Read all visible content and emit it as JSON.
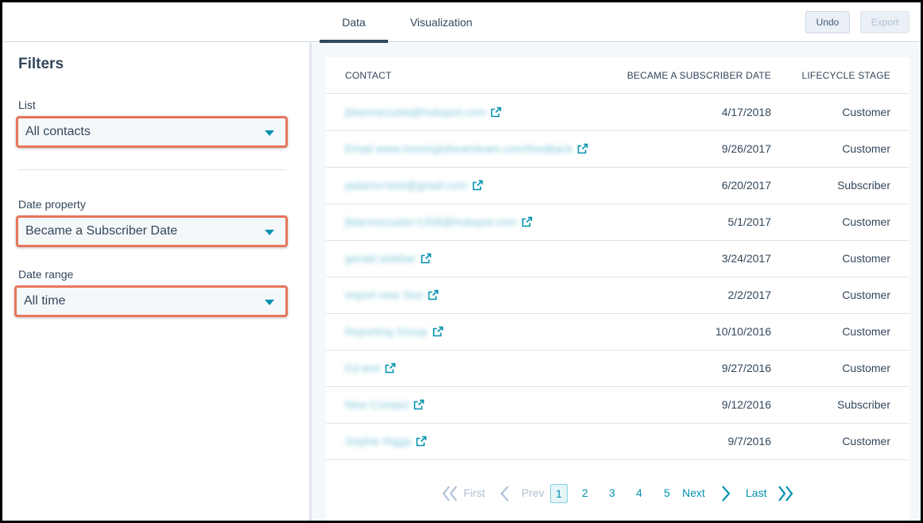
{
  "tabs": [
    {
      "label": "Data",
      "active": true
    },
    {
      "label": "Visualization",
      "active": false
    }
  ],
  "toolbar": {
    "undo_label": "Undo",
    "export_label": "Export"
  },
  "filters": {
    "title": "Filters",
    "list_label": "List",
    "list_value": "All contacts",
    "date_property_label": "Date property",
    "date_property_value": "Became a Subscriber Date",
    "date_range_label": "Date range",
    "date_range_value": "All time"
  },
  "table": {
    "columns": [
      "CONTACT",
      "BECAME A SUBSCRIBER DATE",
      "LIFECYCLE STAGE"
    ],
    "rows": [
      {
        "contact": "jblanmezuela@hubspot.com",
        "date": "4/17/2018",
        "stage": "Customer"
      },
      {
        "contact": "Email www.movingtobeamteam.com/feedback",
        "date": "9/26/2017",
        "stage": "Customer"
      },
      {
        "contact": "jadams+test@gmail.com",
        "date": "6/20/2017",
        "stage": "Subscriber"
      },
      {
        "contact": "jblanmezuela+1208@hubspot.com",
        "date": "5/1/2017",
        "stage": "Customer"
      },
      {
        "contact": "gerald sidebar",
        "date": "3/24/2017",
        "stage": "Customer"
      },
      {
        "contact": "import new Test",
        "date": "2/2/2017",
        "stage": "Customer"
      },
      {
        "contact": "Reporting Group",
        "date": "10/10/2016",
        "stage": "Customer"
      },
      {
        "contact": "Ed test",
        "date": "9/27/2016",
        "stage": "Customer"
      },
      {
        "contact": "New Contact",
        "date": "9/12/2016",
        "stage": "Subscriber"
      },
      {
        "contact": "Sophie Riggs",
        "date": "9/7/2016",
        "stage": "Customer"
      }
    ]
  },
  "pagination": {
    "first": "First",
    "prev": "Prev",
    "pages": [
      "1",
      "2",
      "3",
      "4",
      "5"
    ],
    "current": "1",
    "next": "Next",
    "last": "Last"
  },
  "colors": {
    "accent": "#0091ae",
    "highlight": "#e8765c",
    "text": "#33475b"
  },
  "icons": [
    "external-link-icon",
    "caret-down-icon",
    "chevron-left-icon",
    "chevron-right-icon",
    "double-chevron-left-icon",
    "double-chevron-right-icon"
  ]
}
